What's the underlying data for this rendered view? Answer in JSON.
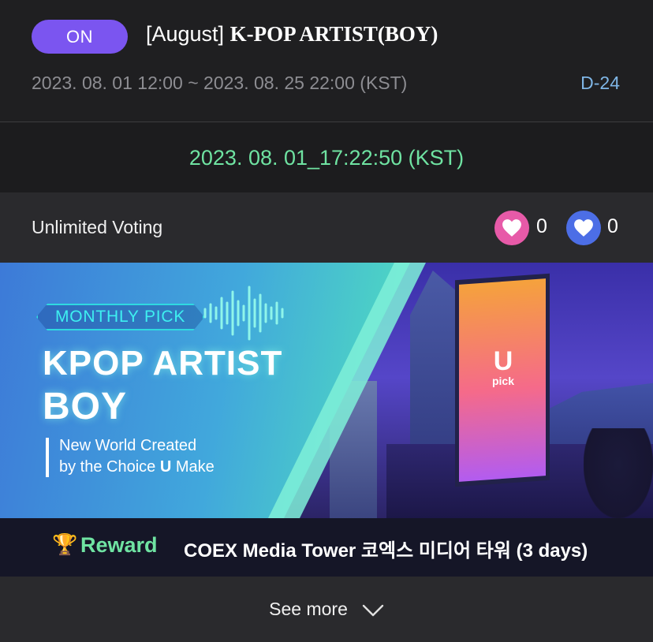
{
  "header": {
    "status": "ON",
    "title_prefix": "[August]",
    "title_main": "K-POP ARTIST(BOY)",
    "period": "2023. 08. 01 12:00 ~ 2023. 08. 25 22:00 (KST)",
    "dday": "D-24"
  },
  "clock": {
    "current_time": "2023. 08. 01_17:22:50 (KST)"
  },
  "voting": {
    "label": "Unlimited Voting",
    "pink_heart_count": "0",
    "blue_heart_count": "0"
  },
  "banner": {
    "pill_label": "MONTHLY PICK",
    "headline_line1": "KPOP ARTIST",
    "headline_line2": "BOY",
    "slogan_line1": "New World Created",
    "slogan_line2_prefix": "by the Choice ",
    "slogan_line2_bold": "U",
    "slogan_line2_suffix": " Make",
    "screen_logo_main": "U",
    "screen_logo_sub": "pick"
  },
  "reward": {
    "icon": "trophy-icon",
    "label": "Reward",
    "text": "COEX Media Tower 코엑스 미디어 타워 (3 days)"
  },
  "see_more": {
    "label": "See more"
  },
  "colors": {
    "status_badge": "#7b55f0",
    "clock_text": "#6fe3a2",
    "dday_text": "#7fb6e6",
    "pink_heart": "#e75aa8",
    "blue_heart": "#4c6ee6",
    "reward_label": "#6fe3a2"
  }
}
